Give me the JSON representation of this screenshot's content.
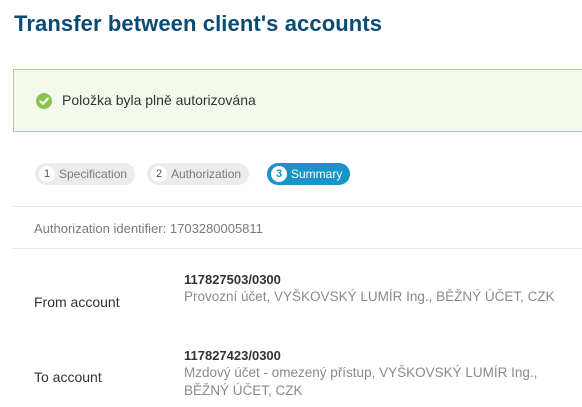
{
  "page": {
    "title": "Transfer between client's accounts"
  },
  "alert": {
    "message": "Položka byla plně autorizována",
    "icon": "check-circle-icon",
    "color": "#8cc152"
  },
  "steps": [
    {
      "number": "1",
      "label": "Specification",
      "active": false
    },
    {
      "number": "2",
      "label": "Authorization",
      "active": false
    },
    {
      "number": "3",
      "label": "Summary",
      "active": true
    }
  ],
  "authorization": {
    "label": "Authorization identifier:",
    "value": "1703280005811"
  },
  "from_account": {
    "label": "From account",
    "number": "117827503/0300",
    "description": "Provozní účet, VYŠKOVSKÝ LUMÍR Ing., BĚŽNÝ ÚČET, CZK"
  },
  "to_account": {
    "label": "To account",
    "number": "117827423/0300",
    "description": "Mzdový účet - omezený přístup, VYŠKOVSKÝ LUMÍR Ing., BĚŽNÝ ÚČET, CZK"
  },
  "colors": {
    "title": "#0b4a72",
    "accent": "#1a93c9",
    "success_border": "#a9d37b",
    "success_bg": "#f3f9ec"
  }
}
